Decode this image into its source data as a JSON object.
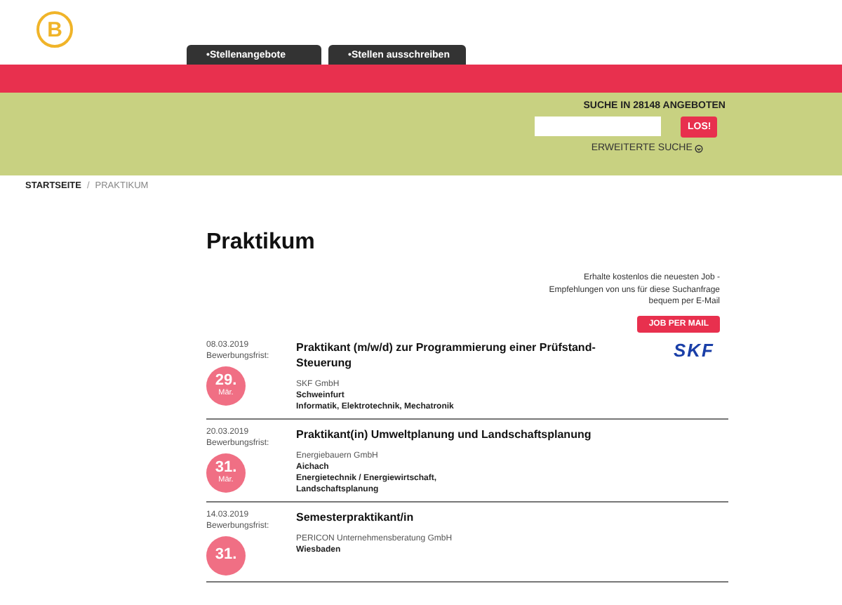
{
  "logo": {
    "letter": "B"
  },
  "nav_tabs": [
    {
      "label": "•Stellenangebote"
    },
    {
      "label": "•Stellen ausschreiben"
    }
  ],
  "search": {
    "heading": "SUCHE IN 28148 ANGEBOTEN",
    "button": "LOS!",
    "advanced": "ERWEITERTE SUCHE"
  },
  "breadcrumb_separator": "/",
  "breadcrumb": [
    {
      "label": "STARTSEITE",
      "current": false
    },
    {
      "label": "PRAKTIKUM",
      "current": true
    }
  ],
  "page_title": "Praktikum",
  "job_mail": {
    "text": "Erhalte kostenlos die neuesten Job - Empfehlungen von uns für diese Suchanfrage bequem per E-Mail",
    "button": "JOB PER MAIL"
  },
  "jobs": [
    {
      "date": "08.03.2019",
      "deadline_label": "Bewerbungsfrist:",
      "deadline_day": "29.",
      "deadline_month": "Mär.",
      "title": "Praktikant (m/w/d) zur Programmierung einer Prüfstand-Steuerung",
      "company": "SKF GmbH",
      "location": "Schweinfurt",
      "fields": "Informatik, Elektrotechnik, Mechatronik",
      "logo": "SKF"
    },
    {
      "date": "20.03.2019",
      "deadline_label": "Bewerbungsfrist:",
      "deadline_day": "31.",
      "deadline_month": "Mär.",
      "title": "Praktikant(in) Umweltplanung und Landschaftsplanung",
      "company": "Energiebauern GmbH",
      "location": "Aichach",
      "fields": "Energietechnik / Energiewirtschaft, Landschaftsplanung"
    },
    {
      "date": "14.03.2019",
      "deadline_label": "Bewerbungsfrist:",
      "deadline_day": "31.",
      "title": "Semesterpraktikant/in",
      "company": "PERICON Unternehmensberatung GmbH",
      "location": "Wiesbaden"
    }
  ]
}
